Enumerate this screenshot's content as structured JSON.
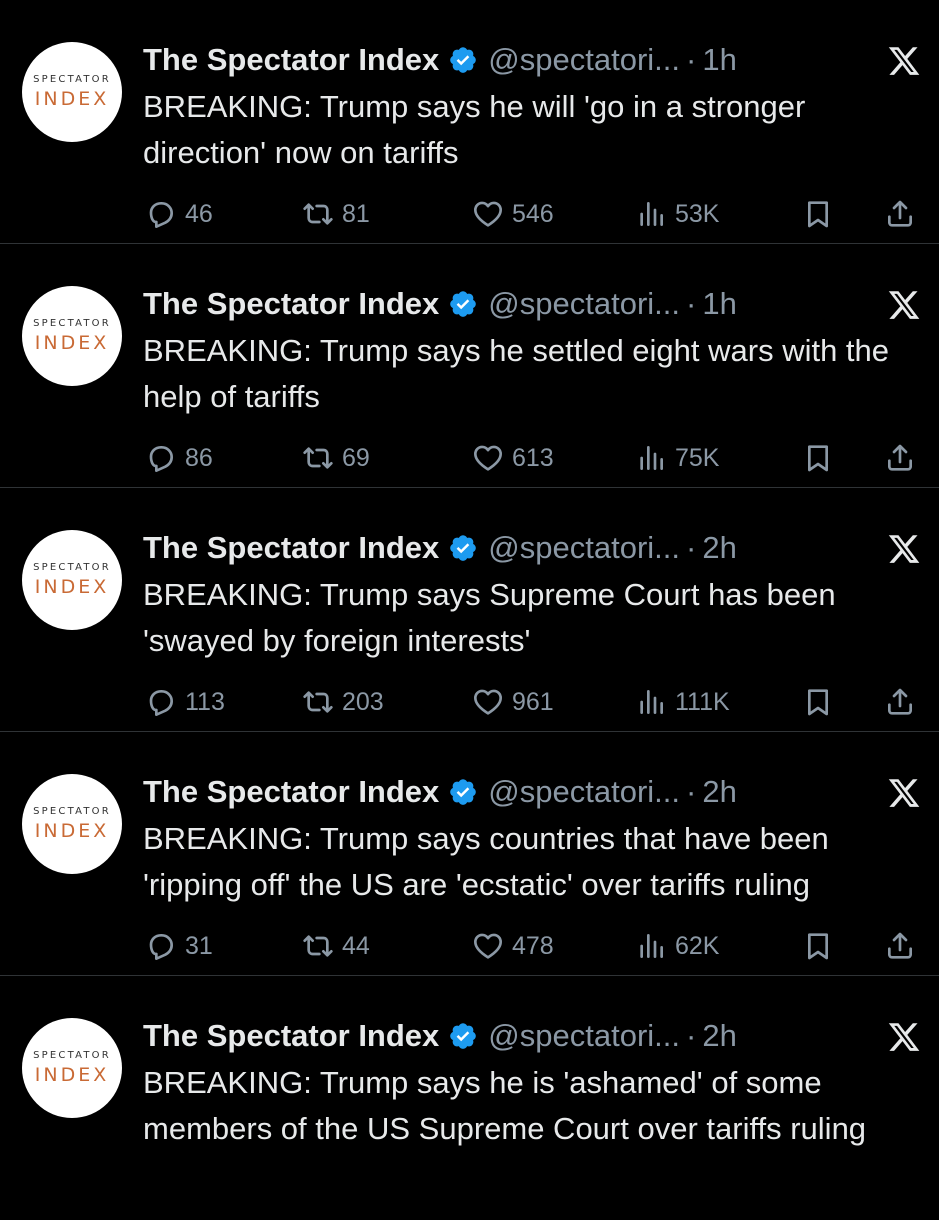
{
  "colors": {
    "background": "#000000",
    "text": "#e7e9ea",
    "muted": "#8b98a5",
    "verified": "#1d9bf0",
    "avatar_accent": "#c96a35"
  },
  "account": {
    "name": "The Spectator Index",
    "handle": "@spectatori...",
    "dot": "·",
    "avatar_text_top": "SPECTATOR",
    "avatar_text_bottom": "INDEX"
  },
  "tweets": [
    {
      "time": "1h",
      "text": "BREAKING: Trump says he will 'go in a stronger direction' now on tariffs",
      "replies": "46",
      "retweets": "81",
      "likes": "546",
      "views": "53K"
    },
    {
      "time": "1h",
      "text": "BREAKING: Trump says he settled eight wars with the help of tariffs",
      "replies": "86",
      "retweets": "69",
      "likes": "613",
      "views": "75K"
    },
    {
      "time": "2h",
      "text": "BREAKING: Trump says Supreme Court has been 'swayed by foreign interests'",
      "replies": "113",
      "retweets": "203",
      "likes": "961",
      "views": "111K"
    },
    {
      "time": "2h",
      "text": "BREAKING: Trump says countries that have been 'ripping off' the US are 'ecstatic' over tariffs ruling",
      "replies": "31",
      "retweets": "44",
      "likes": "478",
      "views": "62K"
    },
    {
      "time": "2h",
      "text": "BREAKING: Trump says he is 'ashamed' of some members of the US Supreme Court over tariffs ruling",
      "replies": "",
      "retweets": "",
      "likes": "",
      "views": ""
    }
  ],
  "icons": [
    "verified-badge-icon",
    "x-logo-icon",
    "reply-icon",
    "retweet-icon",
    "like-icon",
    "views-icon",
    "bookmark-icon",
    "share-icon"
  ]
}
